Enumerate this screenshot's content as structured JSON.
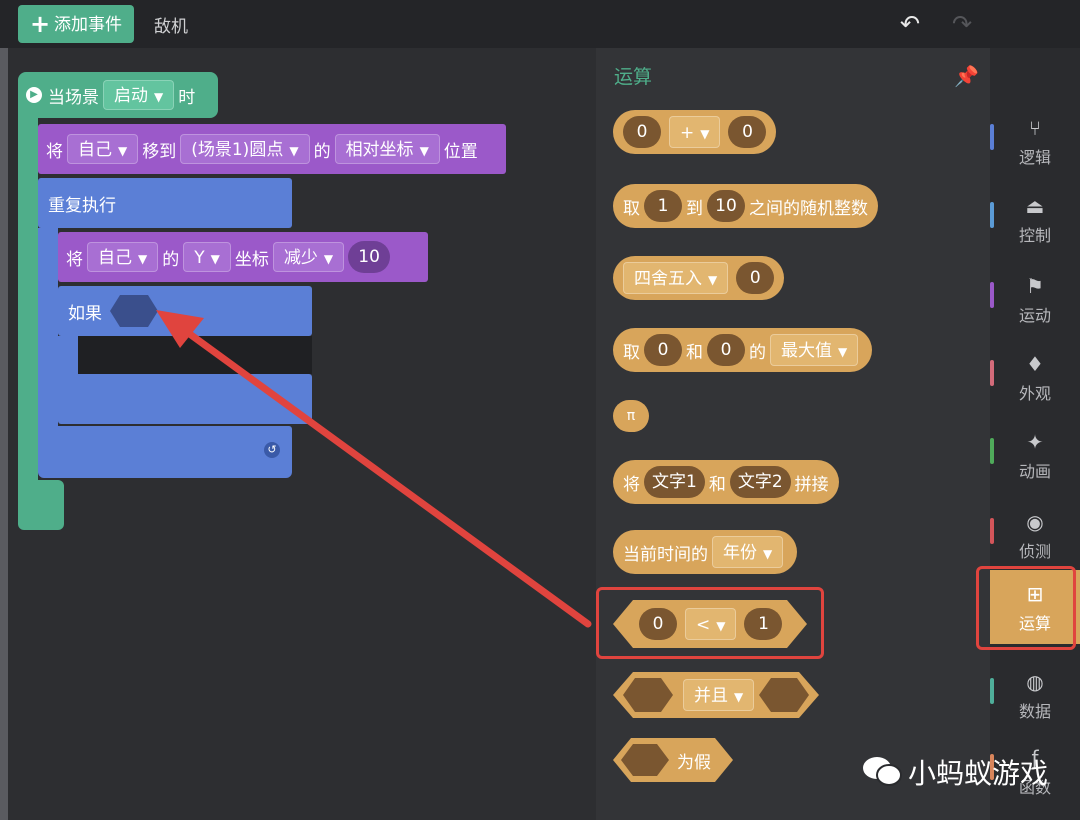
{
  "topbar": {
    "add_event": "添加事件",
    "tab": "敌机",
    "undo_icon": "undo-icon",
    "redo_icon": "redo-icon"
  },
  "workspace": {
    "hat": {
      "prefix": "当场景",
      "dropdown": "启动",
      "suffix": "时"
    },
    "move": {
      "word1": "将",
      "dd1": "自己",
      "word2": "移到",
      "dd2": "(场景1)圆点",
      "word3": "的",
      "dd3": "相对坐标",
      "word4": "位置"
    },
    "repeat": {
      "label": "重复执行"
    },
    "change": {
      "word1": "将",
      "dd1": "自己",
      "word2": "的",
      "dd2": "Y",
      "word3": "坐标",
      "dd3": "减少",
      "value": "10"
    },
    "if": {
      "label": "如果"
    }
  },
  "palette": {
    "title": "运算",
    "blocks": {
      "arith": {
        "a": "0",
        "op": "+",
        "b": "0"
      },
      "random": {
        "w1": "取",
        "a": "1",
        "w2": "到",
        "b": "10",
        "w3": "之间的随机整数"
      },
      "round": {
        "op": "四舍五入",
        "a": "0"
      },
      "max": {
        "w1": "取",
        "a": "0",
        "w2": "和",
        "b": "0",
        "w3": "的",
        "op": "最大值"
      },
      "pi": {
        "label": "π"
      },
      "join": {
        "w1": "将",
        "a": "文字1",
        "w2": "和",
        "b": "文字2",
        "w3": "拼接"
      },
      "time": {
        "w1": "当前时间的",
        "op": "年份"
      },
      "compare": {
        "a": "0",
        "op": "<",
        "b": "1"
      },
      "and": {
        "op": "并且"
      },
      "false": {
        "label": "为假"
      }
    }
  },
  "sidebar": {
    "items": [
      {
        "label": "逻辑",
        "icon": "logic-icon",
        "color": "#5b7fd6"
      },
      {
        "label": "控制",
        "icon": "control-icon",
        "color": "#5b9bd6"
      },
      {
        "label": "运动",
        "icon": "motion-icon",
        "color": "#9b59c9"
      },
      {
        "label": "外观",
        "icon": "looks-icon",
        "color": "#d36b7a"
      },
      {
        "label": "动画",
        "icon": "animation-icon",
        "color": "#4faa5a"
      },
      {
        "label": "侦测",
        "icon": "sensing-icon",
        "color": "#d3555a"
      },
      {
        "label": "运算",
        "icon": "operators-icon",
        "color": "#d8a55b"
      },
      {
        "label": "数据",
        "icon": "data-icon",
        "color": "#4fae9a"
      },
      {
        "label": "函数",
        "icon": "function-icon",
        "color": "#d8855b"
      }
    ]
  },
  "watermark": "小蚂蚁游戏"
}
